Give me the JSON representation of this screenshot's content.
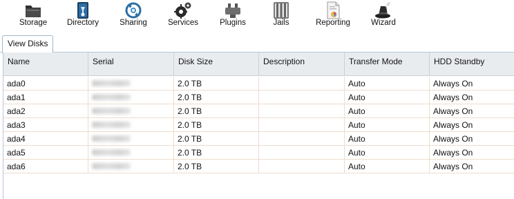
{
  "toolbar": {
    "items": [
      {
        "label": "Storage"
      },
      {
        "label": "Directory"
      },
      {
        "label": "Sharing"
      },
      {
        "label": "Services"
      },
      {
        "label": "Plugins"
      },
      {
        "label": "Jails"
      },
      {
        "label": "Reporting"
      },
      {
        "label": "Wizard"
      }
    ]
  },
  "tabs": [
    {
      "label": "View Disks",
      "active": true
    }
  ],
  "grid": {
    "columns": [
      "Name",
      "Serial",
      "Disk Size",
      "Description",
      "Transfer Mode",
      "HDD Standby"
    ],
    "rows": [
      {
        "name": "ada0",
        "size": "2.0 TB",
        "description": "",
        "transfer_mode": "Auto",
        "hdd_standby": "Always On"
      },
      {
        "name": "ada1",
        "size": "2.0 TB",
        "description": "",
        "transfer_mode": "Auto",
        "hdd_standby": "Always On"
      },
      {
        "name": "ada2",
        "size": "2.0 TB",
        "description": "",
        "transfer_mode": "Auto",
        "hdd_standby": "Always On"
      },
      {
        "name": "ada3",
        "size": "2.0 TB",
        "description": "",
        "transfer_mode": "Auto",
        "hdd_standby": "Always On"
      },
      {
        "name": "ada4",
        "size": "2.0 TB",
        "description": "",
        "transfer_mode": "Auto",
        "hdd_standby": "Always On"
      },
      {
        "name": "ada5",
        "size": "2.0 TB",
        "description": "",
        "transfer_mode": "Auto",
        "hdd_standby": "Always On"
      },
      {
        "name": "ada6",
        "size": "2.0 TB",
        "description": "",
        "transfer_mode": "Auto",
        "hdd_standby": "Always On"
      }
    ]
  },
  "colors": {
    "header_bg": "#e9ecef",
    "row_border": "#eedccc",
    "tab_border": "#9fb6cc"
  }
}
